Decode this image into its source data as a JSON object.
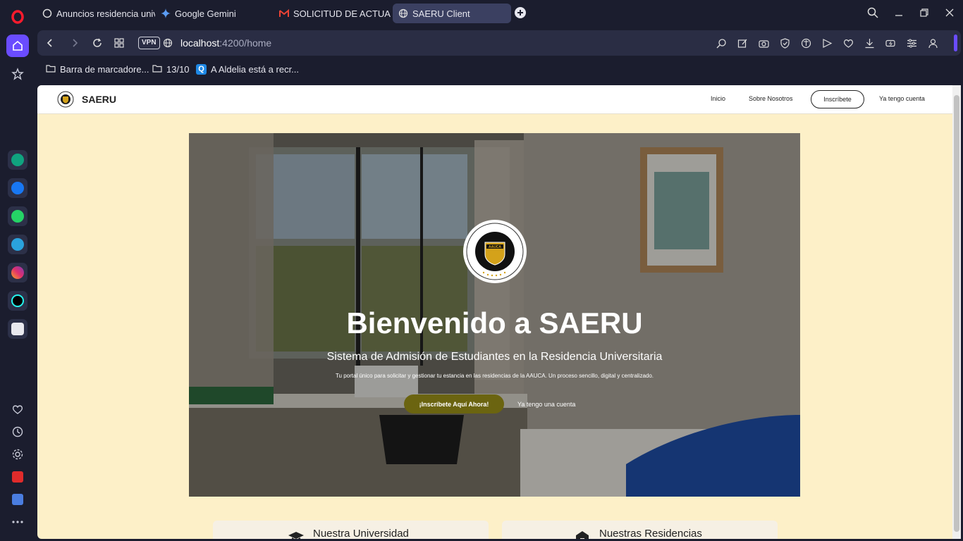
{
  "browser": {
    "tabs": [
      {
        "title": "Anuncios residencia unive",
        "icon": "openai-icon"
      },
      {
        "title": "Google Gemini",
        "icon": "gemini-icon"
      },
      {
        "title": "SOLICITUD DE ACTUALIZA",
        "icon": "gmail-icon"
      },
      {
        "title": "SAERU Client",
        "icon": "globe-icon",
        "active": true
      }
    ],
    "address": {
      "host": "localhost",
      "path": ":4200/home",
      "vpn_label": "VPN"
    },
    "bookmarks": [
      {
        "label": "Barra de marcadore...",
        "icon": "folder-icon"
      },
      {
        "label": "13/10",
        "icon": "folder-icon"
      },
      {
        "label": "A Aldelia está a recr...",
        "icon": "q-icon"
      }
    ]
  },
  "site": {
    "brand": "SAERU",
    "nav": {
      "inicio": "Inicio",
      "sobre": "Sobre Nosotros",
      "inscribete": "Inscríbete",
      "cuenta": "Ya tengo cuenta"
    },
    "hero": {
      "title": "Bienvenido a SAERU",
      "subtitle": "Sistema de Admisión de Estudiantes en la Residencia Universitaria",
      "description": "Tu portal único para solicitar y gestionar tu estancia en las residencias de la AAUCA. Un proceso sencillo, digital y centralizado.",
      "cta": "¡Inscríbete Aquí Ahora!",
      "secondary": "Ya tengo una cuenta",
      "seal_text": "AAUCA"
    },
    "cards": [
      {
        "title": "Nuestra Universidad",
        "icon": "graduation-cap-icon"
      },
      {
        "title": "Nuestras Residencias",
        "icon": "building-icon"
      }
    ]
  },
  "colors": {
    "page_bg": "#fdf0c8",
    "cta_bg": "#6b6410",
    "browser_bg": "#1b1d2e"
  }
}
